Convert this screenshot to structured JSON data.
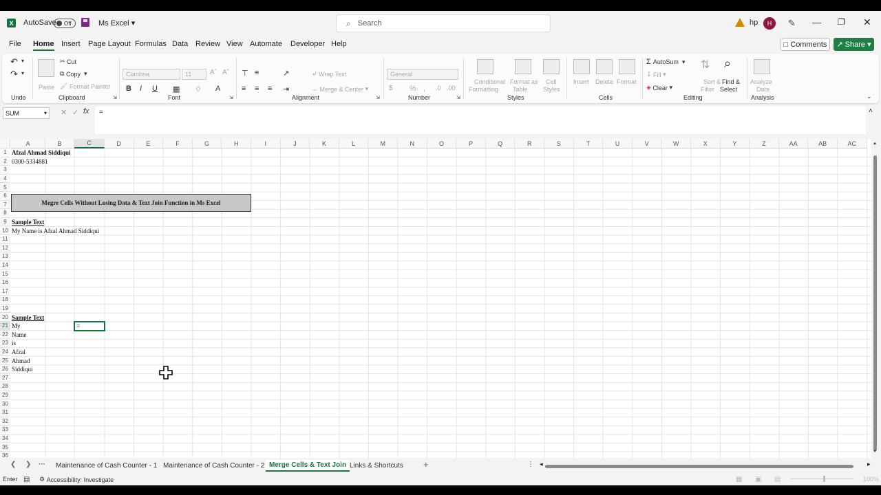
{
  "titlebar": {
    "autosave_label": "AutoSave",
    "autosave_state": "Off",
    "doc_title": "Ms Excel",
    "search_placeholder": "Search",
    "user_name": "hp",
    "user_initial": "H"
  },
  "menu": {
    "tabs": [
      "File",
      "Home",
      "Insert",
      "Page Layout",
      "Formulas",
      "Data",
      "Review",
      "View",
      "Automate",
      "Developer",
      "Help"
    ],
    "active": "Home",
    "comments": "Comments",
    "share": "Share"
  },
  "ribbon": {
    "undo_label": "Undo",
    "paste": "Paste",
    "cut": "Cut",
    "copy": "Copy",
    "format_painter": "Format Painter",
    "clipboard_label": "Clipboard",
    "font_name": "Cambria",
    "font_size": "11",
    "font_label": "Font",
    "wrap_text": "Wrap Text",
    "merge_center": "Merge & Center",
    "alignment_label": "Alignment",
    "number_format": "General",
    "number_label": "Number",
    "conditional_1": "Conditional",
    "conditional_2": "Formatting",
    "format_table_1": "Format as",
    "format_table_2": "Table",
    "cell_styles_1": "Cell",
    "cell_styles_2": "Styles",
    "styles_label": "Styles",
    "insert": "Insert",
    "delete": "Delete",
    "format": "Format",
    "cells_label": "Cells",
    "autosum": "AutoSum",
    "fill": "Fill",
    "clear": "Clear",
    "sort_1": "Sort &",
    "sort_2": "Filter",
    "find_1": "Find &",
    "find_2": "Select",
    "editing_label": "Editing",
    "analyze_1": "Analyze",
    "analyze_2": "Data",
    "analysis_label": "Analysis"
  },
  "formula_bar": {
    "name_box": "SUM",
    "fx": "fx",
    "content": "="
  },
  "grid": {
    "columns": [
      "A",
      "B",
      "C",
      "D",
      "E",
      "F",
      "G",
      "H",
      "I",
      "J",
      "K",
      "L",
      "M",
      "N",
      "O",
      "P",
      "Q",
      "R",
      "S",
      "T",
      "U",
      "V",
      "W",
      "X",
      "Y",
      "Z",
      "AA",
      "AB",
      "AC"
    ],
    "selected_column": "C",
    "rows": [
      "1",
      "2",
      "3",
      "4",
      "5",
      "6",
      "7",
      "8",
      "9",
      "10",
      "11",
      "12",
      "13",
      "14",
      "15",
      "16",
      "17",
      "18",
      "19",
      "20",
      "21",
      "22",
      "23",
      "24",
      "25",
      "26",
      "27",
      "28",
      "29",
      "30",
      "31",
      "32",
      "33",
      "34",
      "35",
      "36"
    ],
    "selected_row": "21",
    "cells": {
      "A1": "Afzal Ahmad Siddiqui",
      "A2": "0300-5334881",
      "A5": "Megre Cells Without Losing Data & Text Join Function in Ms Excel",
      "A9": "Sample Text",
      "A10": "My Name is Afzal Ahmad Siddiqui",
      "A20": "Sample Text",
      "A21": "My",
      "A22": "Name",
      "A23": "is",
      "A24": "Afzal",
      "A25": "Ahmad",
      "A26": "Siddiqui",
      "C21": "="
    }
  },
  "sheets": {
    "tabs": [
      "Maintenance of Cash Counter - 1",
      "Maintenance of Cash Counter - 2",
      "Merge Cells & Text Join",
      "Links & Shortcuts"
    ],
    "active": "Merge Cells & Text Join",
    "more": "···",
    "add": "+"
  },
  "status": {
    "mode": "Enter",
    "accessibility": "Accessibility: Investigate",
    "zoom": "100%"
  }
}
